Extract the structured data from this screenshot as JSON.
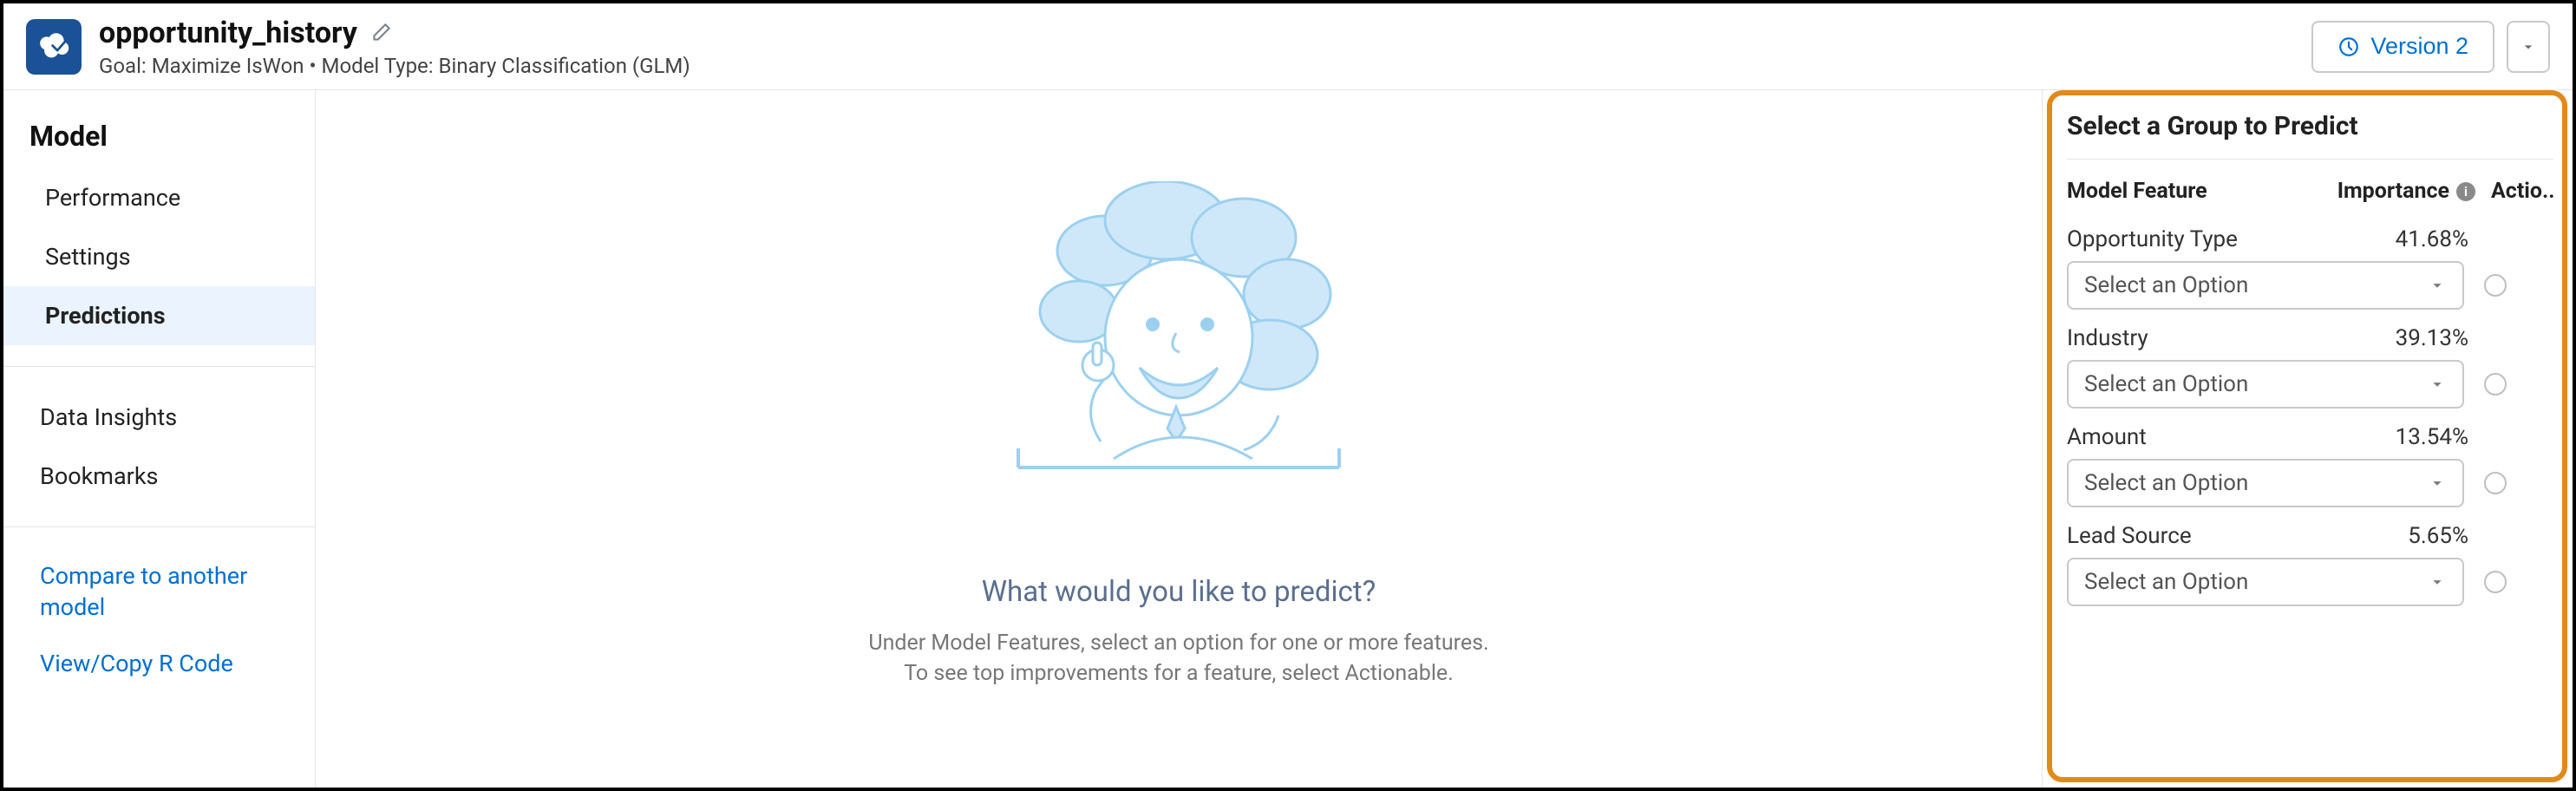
{
  "header": {
    "title": "opportunity_history",
    "subtitle": "Goal: Maximize IsWon • Model Type: Binary Classification (GLM)",
    "version_label": "Version 2"
  },
  "sidebar": {
    "section_title": "Model",
    "items": [
      {
        "label": "Performance",
        "active": false
      },
      {
        "label": "Settings",
        "active": false
      },
      {
        "label": "Predictions",
        "active": true
      }
    ],
    "secondary": [
      {
        "label": "Data Insights"
      },
      {
        "label": "Bookmarks"
      }
    ],
    "links": [
      {
        "label": "Compare to another model"
      },
      {
        "label": "View/Copy R Code"
      }
    ]
  },
  "center": {
    "prompt_title": "What would you like to predict?",
    "prompt_line1": "Under Model Features, select an option for one or more features.",
    "prompt_line2": "To see top improvements for a feature, select Actionable."
  },
  "right": {
    "title": "Select a Group to Predict",
    "col_feature": "Model Feature",
    "col_importance": "Importance",
    "col_action": "Actio...",
    "select_placeholder": "Select an Option",
    "features": [
      {
        "name": "Opportunity Type",
        "importance": "41.68%"
      },
      {
        "name": "Industry",
        "importance": "39.13%"
      },
      {
        "name": "Amount",
        "importance": "13.54%"
      },
      {
        "name": "Lead Source",
        "importance": "5.65%"
      }
    ]
  }
}
